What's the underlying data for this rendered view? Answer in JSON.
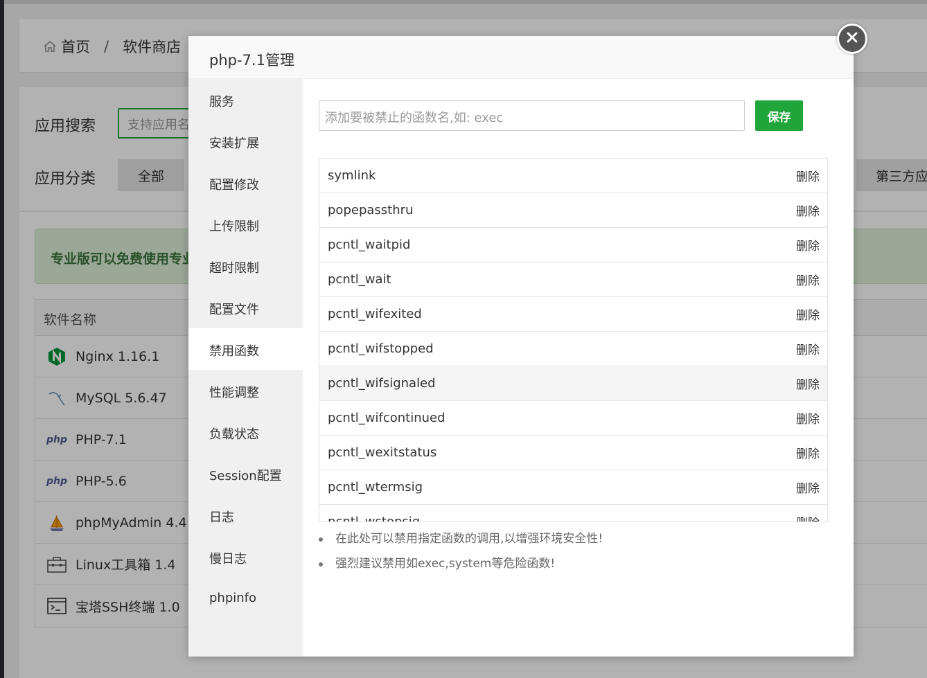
{
  "breadcrumb": {
    "home": "首页",
    "separator": "/",
    "current": "软件商店"
  },
  "store": {
    "search_label": "应用搜索",
    "search_placeholder": "支持应用名",
    "category_label": "应用分类",
    "category_all": "全部",
    "category_third": "第三方应用",
    "pro_banner": "专业版可以免费使用专业",
    "table_header": "软件名称",
    "software": [
      {
        "name": "Nginx 1.16.1",
        "icon": "nginx-icon"
      },
      {
        "name": "MySQL 5.6.47",
        "icon": "mysql-icon"
      },
      {
        "name": "PHP-7.1",
        "icon": "php-icon"
      },
      {
        "name": "PHP-5.6",
        "icon": "php-icon"
      },
      {
        "name": "phpMyAdmin 4.4",
        "icon": "phpmyadmin-icon"
      },
      {
        "name": "Linux工具箱 1.4",
        "icon": "toolbox-icon"
      },
      {
        "name": "宝塔SSH终端 1.0",
        "icon": "terminal-icon"
      }
    ],
    "php_badge": "php"
  },
  "modal": {
    "title": "php-7.1管理",
    "nav": [
      "服务",
      "安装扩展",
      "配置修改",
      "上传限制",
      "超时限制",
      "配置文件",
      "禁用函数",
      "性能调整",
      "负载状态",
      "Session配置",
      "日志",
      "慢日志",
      "phpinfo"
    ],
    "active_nav": "禁用函数",
    "input_placeholder": "添加要被禁止的函数名,如: exec",
    "save_label": "保存",
    "delete_label": "删除",
    "functions": [
      "symlink",
      "popepassthru",
      "pcntl_waitpid",
      "pcntl_wait",
      "pcntl_wifexited",
      "pcntl_wifstopped",
      "pcntl_wifsignaled",
      "pcntl_wifcontinued",
      "pcntl_wexitstatus",
      "pcntl_wtermsig",
      "pcntl_wstopsig"
    ],
    "tips": [
      "在此处可以禁用指定函数的调用,以增强环境安全性!",
      "强烈建议禁用如exec,system等危险函数!"
    ]
  },
  "colors": {
    "accent": "#20a53a",
    "overlay": "rgba(0,0,0,0.3)"
  }
}
